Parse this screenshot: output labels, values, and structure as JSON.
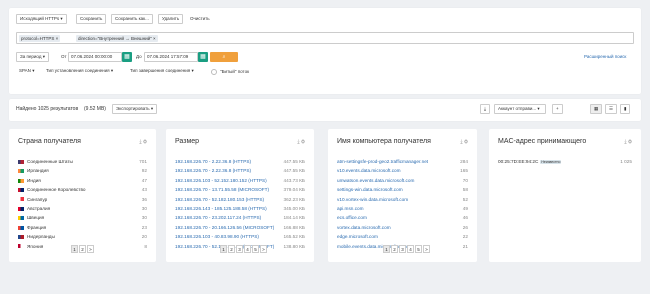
{
  "toolbar": {
    "outgoing_https": "Исходящий HTTPs",
    "save": "Сохранить",
    "save_as": "Сохранить как...",
    "delete": "Удалить",
    "clear": "Очистить"
  },
  "filters": {
    "tag1": "protocol=HTTPS",
    "tag2": "direction=\"Внутренний → Внешний\""
  },
  "period": {
    "label": "За период",
    "from_label": "От",
    "from_value": "07.06.2024 00:00:00",
    "to_label": "До",
    "to_value": "07.06.2024 17:57:09",
    "advanced_search": "Расширенный поиск"
  },
  "options": {
    "span": "SPAN",
    "conn_start_type": "Тип установления соединения",
    "conn_end_type": "Тип завершения соединения",
    "broken_stream": "\"Битый\" поток"
  },
  "results": {
    "found": "Найдено 1025 результатов",
    "size": "(9.52 MB)",
    "export": "Экспортировать",
    "account_send": "Аккаунт отправи..."
  },
  "cards": {
    "country": {
      "title": "Страна получателя",
      "rows": [
        {
          "label": "Соединенные Штаты",
          "value": "701",
          "c1": "#b22234",
          "c2": "#3c3b6e"
        },
        {
          "label": "Ирландия",
          "value": "92",
          "c1": "#169b62",
          "c2": "#ff883e"
        },
        {
          "label": "Индия",
          "value": "47",
          "c1": "#ff9933",
          "c2": "#138808"
        },
        {
          "label": "Соединенное Королевство",
          "value": "43",
          "c1": "#012169",
          "c2": "#c8102e"
        },
        {
          "label": "Сингапур",
          "value": "36",
          "c1": "#ef3340",
          "c2": "#ffffff"
        },
        {
          "label": "Австралия",
          "value": "30",
          "c1": "#012169",
          "c2": "#e4002b"
        },
        {
          "label": "Швеция",
          "value": "30",
          "c1": "#006aa7",
          "c2": "#fecc00"
        },
        {
          "label": "Франция",
          "value": "23",
          "c1": "#0055a4",
          "c2": "#ef4135"
        },
        {
          "label": "Нидерланды",
          "value": "20",
          "c1": "#ae1c28",
          "c2": "#21468b"
        },
        {
          "label": "Япония",
          "value": "8",
          "c1": "#ffffff",
          "c2": "#bc002d"
        }
      ],
      "pages": [
        "1",
        "2",
        ">"
      ]
    },
    "size": {
      "title": "Размер",
      "rows": [
        {
          "label": "192.168.226.70 - 2.22.36.8 (HTTPS)",
          "value": "447.55 КБ"
        },
        {
          "label": "192.168.226.70 - 2.22.36.8 (HTTPS)",
          "value": "447.55 КБ"
        },
        {
          "label": "192.168.226.103 - 52.152.180.152 (HTTPS)",
          "value": "443.73 КБ"
        },
        {
          "label": "192.168.226.70 - 13.71.55.58 (MICROSOFT)",
          "value": "379.04 КБ"
        },
        {
          "label": "192.168.226.70 - 52.182.180.153 (HTTPS)",
          "value": "362.23 КБ"
        },
        {
          "label": "192.168.226.143 - 185.125.188.58 (HTTPS)",
          "value": "345.00 КБ"
        },
        {
          "label": "192.168.226.70 - 23.202.117.24 (HTTPS)",
          "value": "184.14 КБ"
        },
        {
          "label": "192.168.226.70 - 20.166.126.56 (MICROSOFT)",
          "value": "166.88 КБ"
        },
        {
          "label": "192.168.226.103 - 40.83.98.90 (HTTPS)",
          "value": "165.52 КБ"
        },
        {
          "label": "192.168.226.70 - 52.165.164.15 (MICROSOFT)",
          "value": "138.80 КБ"
        }
      ],
      "pages": [
        "1",
        "2",
        "3",
        "4",
        "5",
        ">"
      ]
    },
    "host": {
      "title": "Имя компьютера получателя",
      "rows": [
        {
          "label": "atm-settingsfe-prod-geo2.trafficmanager.net",
          "value": "284"
        },
        {
          "label": "v10.events.data.microsoft.com",
          "value": "165"
        },
        {
          "label": "umwatson.events.data.microsoft.com",
          "value": "70"
        },
        {
          "label": "settings-win.data.microsoft.com",
          "value": "58"
        },
        {
          "label": "v10.vortex-win.data.microsoft.com",
          "value": "52"
        },
        {
          "label": "api.msn.com",
          "value": "49"
        },
        {
          "label": "ecs.office.com",
          "value": "46"
        },
        {
          "label": "vortex.data.microsoft.com",
          "value": "26"
        },
        {
          "label": "edge.microsoft.com",
          "value": "22"
        },
        {
          "label": "mobile.events.data.microsoft.com",
          "value": "21"
        }
      ],
      "pages": [
        "1",
        "2",
        "3",
        "4",
        "5",
        ">"
      ]
    },
    "mac": {
      "title": "MAC-адрес принимающего",
      "rows": [
        {
          "label": "00:25:7D:EE:94:2C",
          "badge": "Неизвестно",
          "value": "1 025"
        }
      ]
    }
  }
}
